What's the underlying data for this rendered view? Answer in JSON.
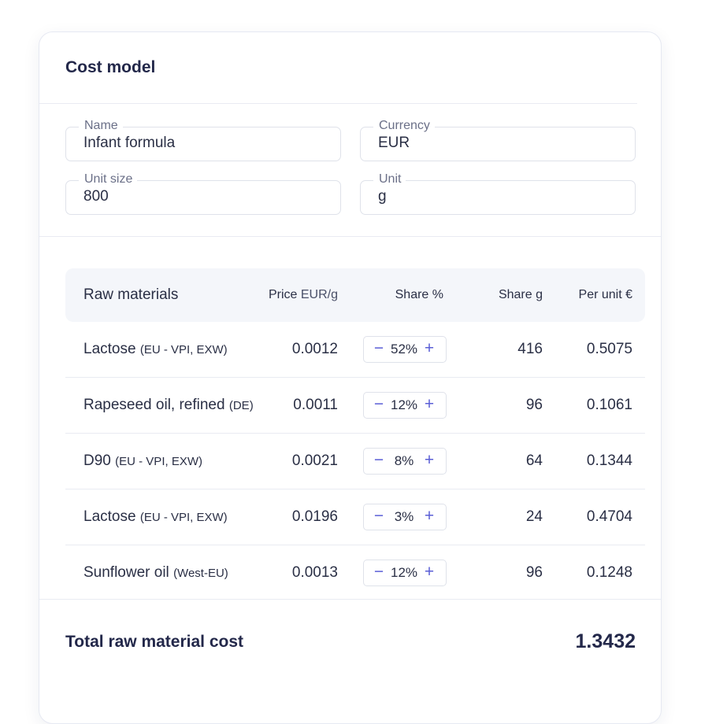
{
  "card": {
    "title": "Cost model"
  },
  "fields": {
    "name": {
      "label": "Name",
      "value": "Infant formula"
    },
    "currency": {
      "label": "Currency",
      "value": "EUR"
    },
    "unit_size": {
      "label": "Unit size",
      "value": "800"
    },
    "unit": {
      "label": "Unit",
      "value": "g"
    }
  },
  "table": {
    "headers": {
      "name": "Raw materials",
      "price": "Price",
      "price_unit": "EUR/g",
      "share_pct": "Share %",
      "share_g": "Share g",
      "per_unit": "Per unit €"
    },
    "rows": [
      {
        "name": "Lactose",
        "origin": "(EU - VPI, EXW)",
        "price": "0.0012",
        "share_pct": "52%",
        "share_g": "416",
        "per_unit": "0.5075"
      },
      {
        "name": "Rapeseed oil, refined",
        "origin": "(DE)",
        "price": "0.0011",
        "share_pct": "12%",
        "share_g": "96",
        "per_unit": "0.1061"
      },
      {
        "name": "D90",
        "origin": "(EU - VPI, EXW)",
        "price": "0.0021",
        "share_pct": "8%",
        "share_g": "64",
        "per_unit": "0.1344"
      },
      {
        "name": "Lactose",
        "origin": "(EU - VPI, EXW)",
        "price": "0.0196",
        "share_pct": "3%",
        "share_g": "24",
        "per_unit": "0.4704"
      },
      {
        "name": "Sunflower oil",
        "origin": "(West-EU)",
        "price": "0.0013",
        "share_pct": "12%",
        "share_g": "96",
        "per_unit": "0.1248"
      }
    ],
    "stepper": {
      "minus": "−",
      "plus": "+"
    }
  },
  "total": {
    "label": "Total raw material cost",
    "value": "1.3432"
  },
  "colors": {
    "accent": "#5b5fd6",
    "text": "#2a2f45",
    "header_bg": "#f4f6fa",
    "border": "#dfe2ea"
  }
}
